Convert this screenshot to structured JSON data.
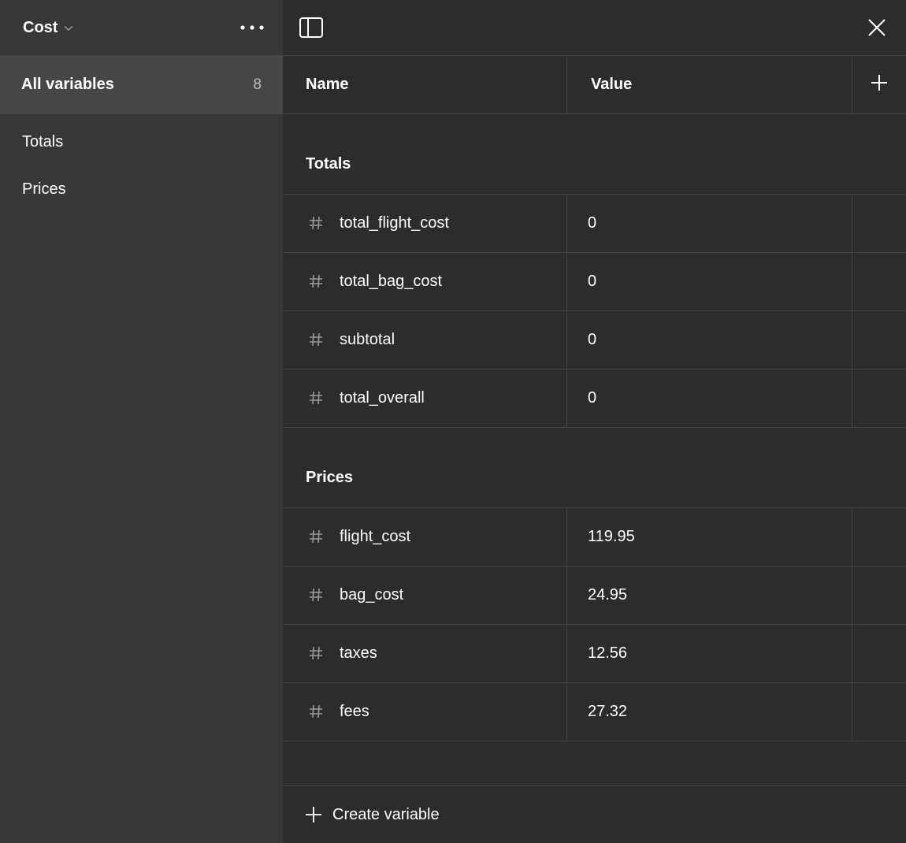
{
  "sidebar": {
    "collection_name": "Cost",
    "all_label": "All variables",
    "all_count": "8",
    "groups": [
      {
        "label": "Totals"
      },
      {
        "label": "Prices"
      }
    ]
  },
  "table": {
    "col_name": "Name",
    "col_value": "Value",
    "groups": [
      {
        "title": "Totals",
        "rows": [
          {
            "name": "total_flight_cost",
            "value": "0"
          },
          {
            "name": "total_bag_cost",
            "value": "0"
          },
          {
            "name": "subtotal",
            "value": "0"
          },
          {
            "name": "total_overall",
            "value": "0"
          }
        ]
      },
      {
        "title": "Prices",
        "rows": [
          {
            "name": "flight_cost",
            "value": "119.95"
          },
          {
            "name": "bag_cost",
            "value": "24.95"
          },
          {
            "name": "taxes",
            "value": "12.56"
          },
          {
            "name": "fees",
            "value": "27.32"
          }
        ]
      }
    ]
  },
  "footer": {
    "create_label": "Create variable"
  },
  "icons": {
    "type_icon": "hash-icon",
    "dropdown": "chevron-down-icon",
    "more": "more-horizontal-icon",
    "panel": "sidebar-toggle-icon",
    "close": "close-icon",
    "add": "plus-icon"
  }
}
